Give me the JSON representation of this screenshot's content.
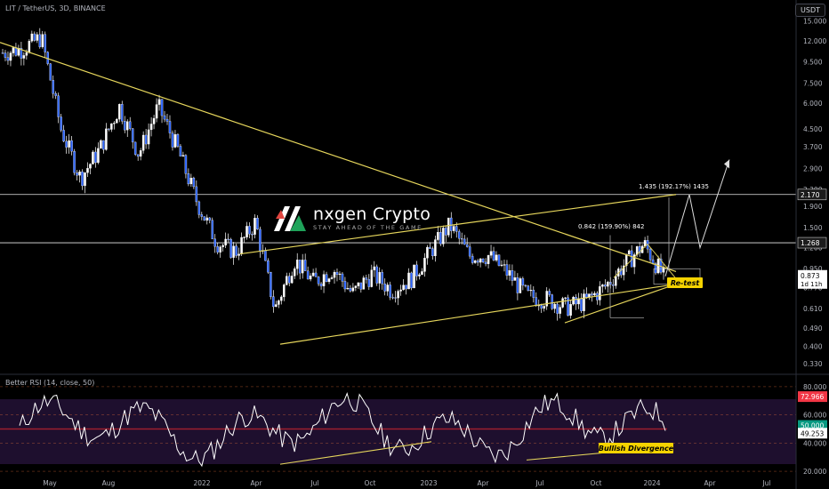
{
  "header": {
    "symbol_title": "LIT / TetherUS, 3D, BINANCE",
    "currency_button": "USDT"
  },
  "watermark": {
    "brand": "nxgen Crypto",
    "tagline": "STAY AHEAD OF THE GAME",
    "icon": "nxgen-logo-icon"
  },
  "price_axis": {
    "scale": "log",
    "ticks": [
      "15.000",
      "12.000",
      "9.500",
      "7.500",
      "6.000",
      "4.500",
      "3.700",
      "2.900",
      "2.300",
      "1.900",
      "1.500",
      "1.200",
      "0.950",
      "0.770",
      "0.610",
      "0.490",
      "0.400",
      "0.330"
    ],
    "current_price_label": "0.873",
    "countdown_label": "1d 11h",
    "level_labels": [
      "2.170",
      "1.268"
    ]
  },
  "rsi_panel": {
    "title": "Better RSI (14, close, 50)",
    "ticks": [
      "80.000",
      "60.000",
      "40.000",
      "20.000"
    ],
    "labels": {
      "upper": "72.966",
      "mid": "50.000",
      "current": "49.253"
    },
    "colors": {
      "upper_bg": "#f23645",
      "mid_bg": "#089981",
      "line": "#ffffff",
      "band": "#3b1f5a"
    }
  },
  "time_axis": {
    "ticks": [
      "May",
      "Aug",
      "2022",
      "Apr",
      "Jul",
      "Oct",
      "2023",
      "Apr",
      "Jul",
      "Oct",
      "2024",
      "Apr",
      "Jul"
    ]
  },
  "annotations": {
    "measure_1": "0.842 (159.90%) 842",
    "measure_2": "1.435 (192.17%) 1435",
    "retest": "Re-test",
    "divergence": "Bullish Divergence"
  },
  "colors": {
    "bg": "#000000",
    "candle": "#ffffff",
    "trendline": "#e6d65c",
    "level_line": "#e8e8e8",
    "label_yellow": "#f5d300",
    "axis_text": "#b2b5be"
  },
  "chart_data": [
    {
      "type": "candlestick",
      "title": "LIT / TetherUS, 3D, BINANCE",
      "yscale": "log",
      "ylim": [
        0.3,
        17
      ],
      "x_ticks": [
        "May",
        "Aug",
        "2022",
        "Apr",
        "Jul",
        "Oct",
        "2023",
        "Apr",
        "Jul",
        "Oct",
        "2024",
        "Apr",
        "Jul"
      ],
      "close_path": [
        {
          "t": "Mar 2021",
          "p": 10.5
        },
        {
          "t": "Apr 2021",
          "p": 11.0
        },
        {
          "t": "May 2021",
          "p": 12.5
        },
        {
          "t": "Jun 2021",
          "p": 4.5
        },
        {
          "t": "Jul 2021",
          "p": 2.6
        },
        {
          "t": "Aug 2021",
          "p": 3.6
        },
        {
          "t": "Sep 2021",
          "p": 5.8
        },
        {
          "t": "Oct 2021",
          "p": 3.4
        },
        {
          "t": "Nov 2021",
          "p": 5.8
        },
        {
          "t": "Dec 2021",
          "p": 3.6
        },
        {
          "t": "Jan 2022",
          "p": 2.0
        },
        {
          "t": "Feb 2022",
          "p": 1.28
        },
        {
          "t": "Mar 2022",
          "p": 1.15
        },
        {
          "t": "Apr 2022",
          "p": 1.6
        },
        {
          "t": "May 2022",
          "p": 0.6
        },
        {
          "t": "Jun 2022",
          "p": 1.05
        },
        {
          "t": "Jul 2022",
          "p": 0.82
        },
        {
          "t": "Aug 2022",
          "p": 0.95
        },
        {
          "t": "Sep 2022",
          "p": 0.72
        },
        {
          "t": "Oct 2022",
          "p": 0.9
        },
        {
          "t": "Nov 2022",
          "p": 0.75
        },
        {
          "t": "Dec 2022",
          "p": 0.85
        },
        {
          "t": "Jan 2023",
          "p": 1.15
        },
        {
          "t": "Feb 2023",
          "p": 1.55
        },
        {
          "t": "Mar 2023",
          "p": 1.1
        },
        {
          "t": "Apr 2023",
          "p": 1.1
        },
        {
          "t": "May 2023",
          "p": 0.9
        },
        {
          "t": "Jun 2023",
          "p": 0.7
        },
        {
          "t": "Jul 2023",
          "p": 0.68
        },
        {
          "t": "Aug 2023",
          "p": 0.62
        },
        {
          "t": "Sep 2023",
          "p": 0.66
        },
        {
          "t": "Oct 2023",
          "p": 0.78
        },
        {
          "t": "Nov 2023",
          "p": 1.0
        },
        {
          "t": "Dec 2023",
          "p": 1.25
        },
        {
          "t": "Jan 2024",
          "p": 0.873
        }
      ],
      "horizontal_levels": [
        2.17,
        1.268
      ],
      "projection_path": [
        0.873,
        2.17,
        1.2,
        3.2
      ]
    },
    {
      "type": "line",
      "title": "Better RSI (14, close, 50)",
      "ylim": [
        15,
        85
      ],
      "levels": [
        72.966,
        50.0
      ],
      "last_value": 49.253
    }
  ]
}
